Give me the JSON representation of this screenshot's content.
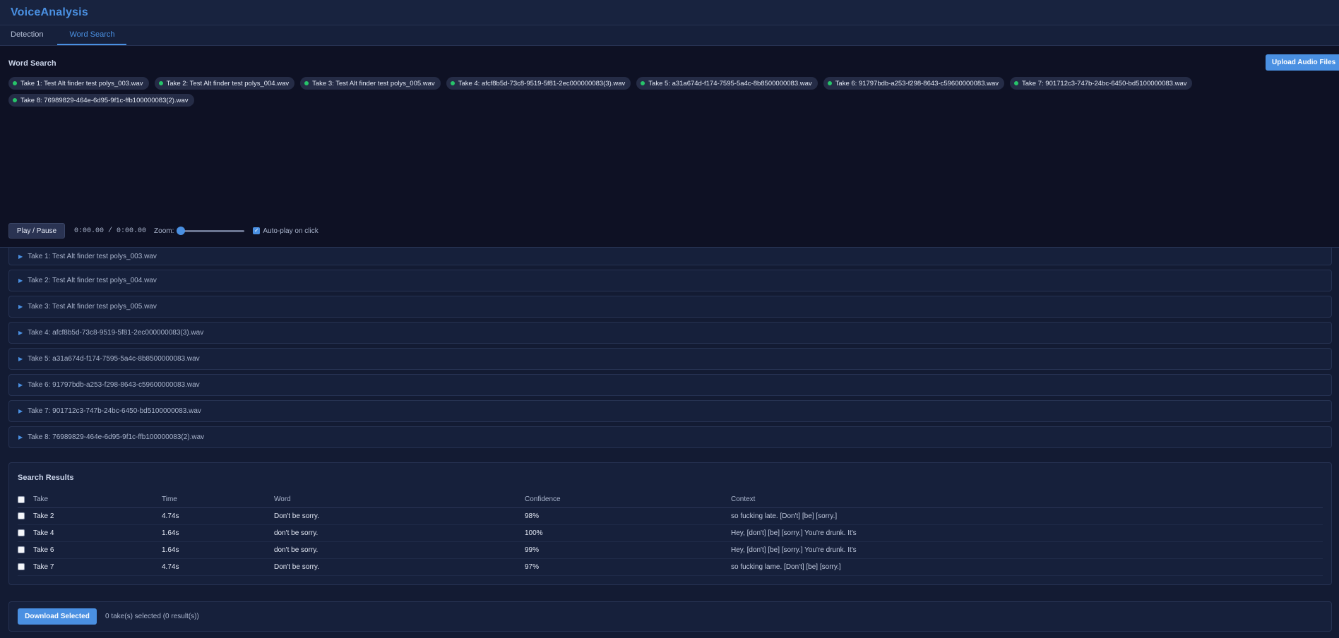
{
  "app": {
    "title": "VoiceAnalysis"
  },
  "tabs": [
    {
      "label": "Detection",
      "active": false
    },
    {
      "label": "Word Search",
      "active": true
    }
  ],
  "word_search": {
    "title": "Word Search",
    "upload_label": "Upload Audio Files",
    "takes": [
      "Take 1: Test Alt finder test polys_003.wav",
      "Take 2: Test Alt finder test polys_004.wav",
      "Take 3: Test Alt finder test polys_005.wav",
      "Take 4: afcf8b5d-73c8-9519-5f81-2ec000000083(3).wav",
      "Take 5: a31a674d-f174-7595-5a4c-8b8500000083.wav",
      "Take 6: 91797bdb-a253-f298-8643-c59600000083.wav",
      "Take 7: 901712c3-747b-24bc-6450-bd5100000083.wav",
      "Take 8: 76989829-464e-6d95-9f1c-ffb100000083(2).wav"
    ],
    "loaded_dot_color": "#27c46a",
    "controls": {
      "play_pause_label": "Play / Pause",
      "time_display": "0:00.00 / 0:00.00",
      "zoom_label": "Zoom:",
      "zoom_level": 0,
      "autoplay_label": "Auto-play on click",
      "autoplay_checked": true
    }
  },
  "results": {
    "title": "Search Results",
    "columns": [
      "Take",
      "Time",
      "Word",
      "Confidence",
      "Context"
    ],
    "rows": [
      {
        "take": "Take 2",
        "time": "4.74s",
        "word": "Don't be sorry.",
        "confidence": "98%",
        "context": "so fucking late. [Don't] [be] [sorry.]"
      },
      {
        "take": "Take 4",
        "time": "1.64s",
        "word": "don't be sorry.",
        "confidence": "100%",
        "context": "Hey, [don't] [be] [sorry.] You're drunk. It's"
      },
      {
        "take": "Take 6",
        "time": "1.64s",
        "word": "don't be sorry.",
        "confidence": "99%",
        "context": "Hey, [don't] [be] [sorry.] You're drunk. It's"
      },
      {
        "take": "Take 7",
        "time": "4.74s",
        "word": "Don't be sorry.",
        "confidence": "97%",
        "context": "so fucking lame. [Don't] [be] [sorry.]"
      }
    ]
  },
  "download": {
    "button_label": "Download Selected",
    "status": "0 take(s) selected (0 result(s))"
  },
  "colors": {
    "accent": "#4a90e2",
    "background": "#131b33",
    "waveform_bg": "#0e1124"
  }
}
